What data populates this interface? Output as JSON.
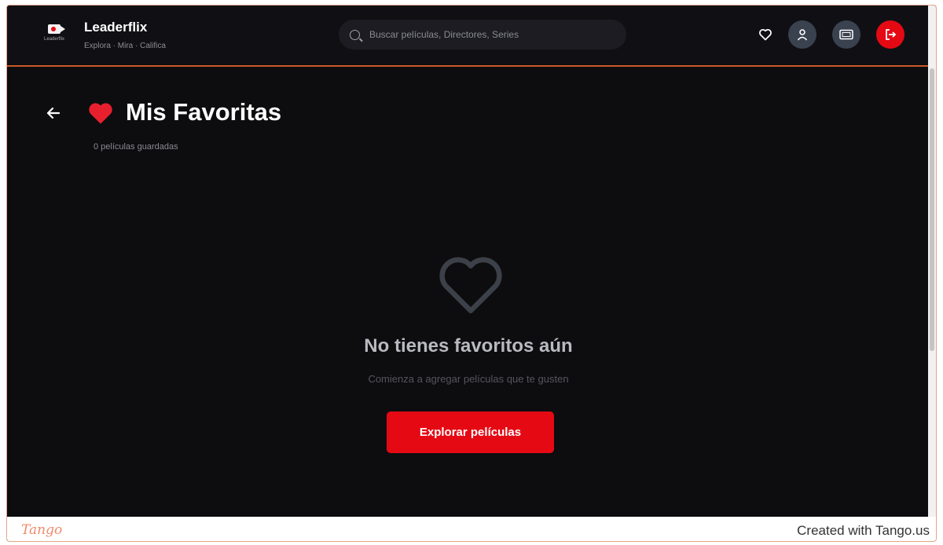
{
  "header": {
    "brand_name": "Leaderflix",
    "brand_tagline": "Explora · Mira · Califica",
    "logo_small_text": "Leaderflix",
    "search_placeholder": "Buscar películas, Directores, Series",
    "icons": [
      "heart-outline-icon",
      "user-icon",
      "card-icon",
      "logout-icon"
    ],
    "accent_color": "#e50914"
  },
  "page": {
    "title": "Mis Favoritas",
    "saved_count": "0 películas guardadas"
  },
  "empty_state": {
    "title": "No tienes favoritos aún",
    "subtitle": "Comienza a agregar películas que te gusten",
    "button_label": "Explorar películas"
  },
  "footer": {
    "tango_logo": "Tango",
    "credit": "Created with Tango.us"
  }
}
